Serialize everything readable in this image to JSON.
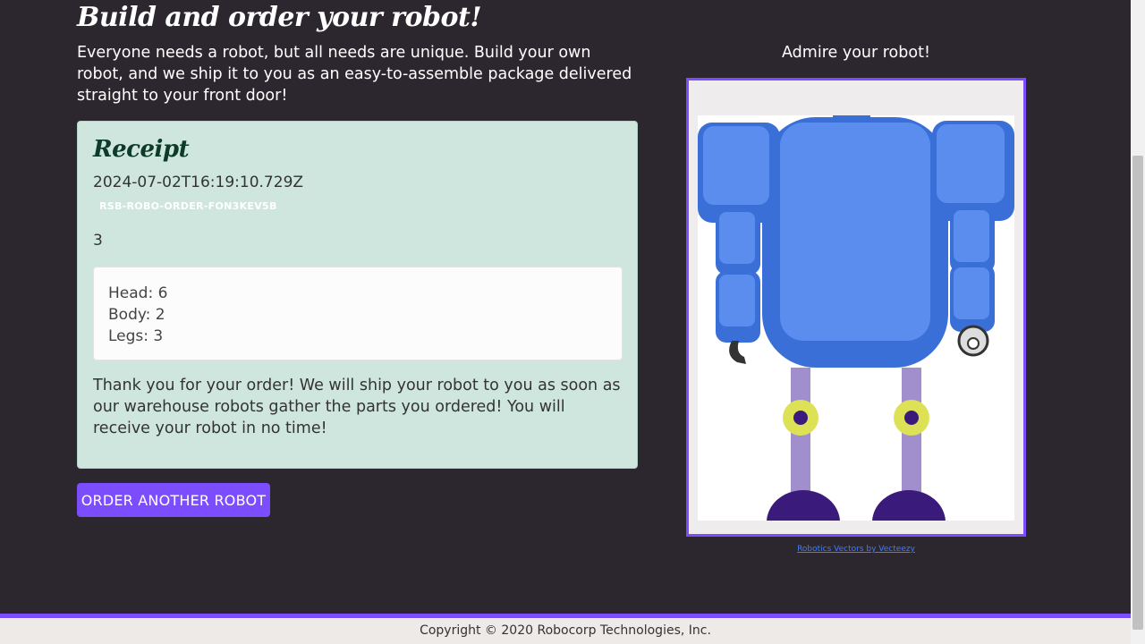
{
  "header": {
    "title": "Build and order your robot!",
    "intro": "Everyone needs a robot, but all needs are unique. Build your own robot, and we ship it to you as an easy-to-assemble package delivered straight to your front door!"
  },
  "receipt": {
    "title": "Receipt",
    "timestamp": "2024-07-02T16:19:10.729Z",
    "order_id": "RSB-ROBO-ORDER-FON3KEV5B",
    "address": "3",
    "parts": {
      "head": "Head: 6",
      "body": "Body: 2",
      "legs": "Legs: 3"
    },
    "thanks": "Thank you for your order! We will ship your robot to you as soon as our warehouse robots gather the parts you ordered! You will receive your robot in no time!"
  },
  "actions": {
    "order_another_label": "ORDER ANOTHER ROBOT"
  },
  "preview": {
    "heading": "Admire your robot!",
    "image_alt": "Robot preview",
    "credit_link": "Robotics Vectors by Vecteezy"
  },
  "footer": {
    "copyright": "Copyright © 2020 Robocorp Technologies, Inc."
  },
  "colors": {
    "accent": "#7c4dff",
    "background": "#2c272e",
    "receipt_bg": "#cfe6de",
    "robot_blue": "#5b8def",
    "robot_leg": "#a08fcc",
    "robot_joint": "#dde156",
    "robot_foot": "#3a1a7a"
  }
}
